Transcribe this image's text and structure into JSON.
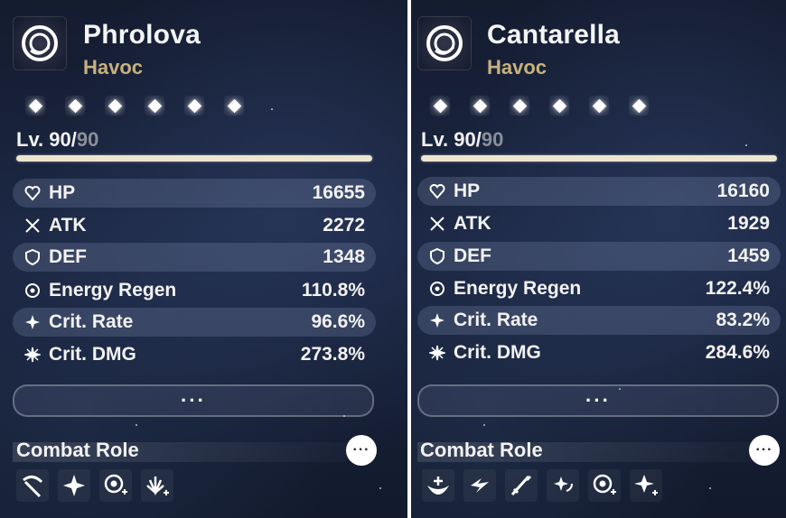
{
  "left": {
    "name": "Phrolova",
    "element": "Havoc",
    "level_current": "Lv. 90/",
    "level_max": "90",
    "stats": [
      {
        "label": "HP",
        "value": "16655",
        "icon": "hp-heart-icon"
      },
      {
        "label": "ATK",
        "value": "2272",
        "icon": "atk-swords-icon"
      },
      {
        "label": "DEF",
        "value": "1348",
        "icon": "def-shield-icon"
      },
      {
        "label": "Energy Regen",
        "value": "110.8%",
        "icon": "energy-regen-icon"
      },
      {
        "label": "Crit. Rate",
        "value": "96.6%",
        "icon": "crit-rate-icon"
      },
      {
        "label": "Crit. DMG",
        "value": "273.8%",
        "icon": "crit-dmg-icon"
      }
    ],
    "more_label": "···",
    "combat_role_label": "Combat Role",
    "combat_role_more": "···",
    "sequence_count": 6
  },
  "right": {
    "name": "Cantarella",
    "element": "Havoc",
    "level_current": "Lv. 90/",
    "level_max": "90",
    "stats": [
      {
        "label": "HP",
        "value": "16160",
        "icon": "hp-heart-icon"
      },
      {
        "label": "ATK",
        "value": "1929",
        "icon": "atk-swords-icon"
      },
      {
        "label": "DEF",
        "value": "1459",
        "icon": "def-shield-icon"
      },
      {
        "label": "Energy Regen",
        "value": "122.4%",
        "icon": "energy-regen-icon"
      },
      {
        "label": "Crit. Rate",
        "value": "83.2%",
        "icon": "crit-rate-icon"
      },
      {
        "label": "Crit. DMG",
        "value": "284.6%",
        "icon": "crit-dmg-icon"
      }
    ],
    "more_label": "···",
    "combat_role_label": "Combat Role",
    "combat_role_more": "···",
    "sequence_count": 6
  },
  "colors": {
    "element_gold": "#c8b27c",
    "level_bar": "#ece6cf",
    "text": "#f4f4f4",
    "level_max_grey": "#8a8f99"
  }
}
